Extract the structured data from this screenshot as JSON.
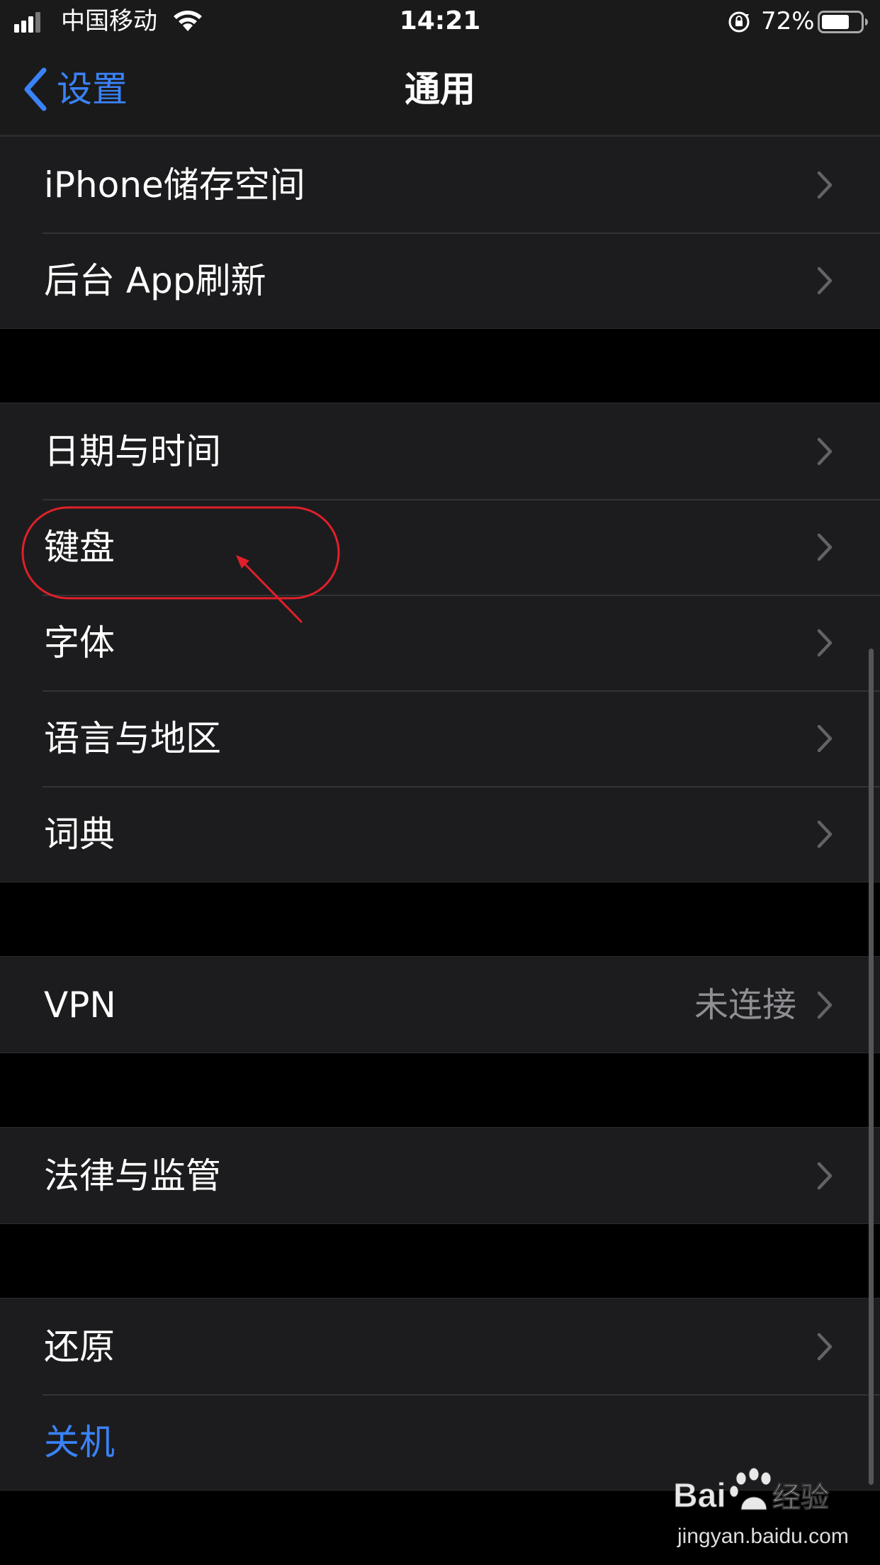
{
  "status_bar": {
    "carrier": "中国移动",
    "time": "14:21",
    "battery_percent": "72%",
    "battery_level": 0.72,
    "icons": [
      "signal-icon",
      "wifi-icon",
      "rotation-lock-icon",
      "battery-icon"
    ]
  },
  "nav": {
    "back_label": "设置",
    "title": "通用"
  },
  "groups": [
    {
      "rows": [
        {
          "label": "iPhone储存空间"
        },
        {
          "label": "后台 App刷新"
        }
      ]
    },
    {
      "rows": [
        {
          "label": "日期与时间"
        },
        {
          "label": "键盘"
        },
        {
          "label": "字体"
        },
        {
          "label": "语言与地区"
        },
        {
          "label": "词典"
        }
      ]
    },
    {
      "rows": [
        {
          "label": "VPN",
          "value": "未连接"
        }
      ]
    },
    {
      "rows": [
        {
          "label": "法律与监管"
        }
      ]
    },
    {
      "rows": [
        {
          "label": "还原"
        },
        {
          "label": "关机"
        }
      ]
    }
  ],
  "colors": {
    "accent": "#3a82f7",
    "annotation": "#e0202a",
    "background": "#000000",
    "cell": "#1c1c1e"
  },
  "watermark": {
    "brand": "Baidu经验",
    "url": "jingyan.baidu.com"
  }
}
